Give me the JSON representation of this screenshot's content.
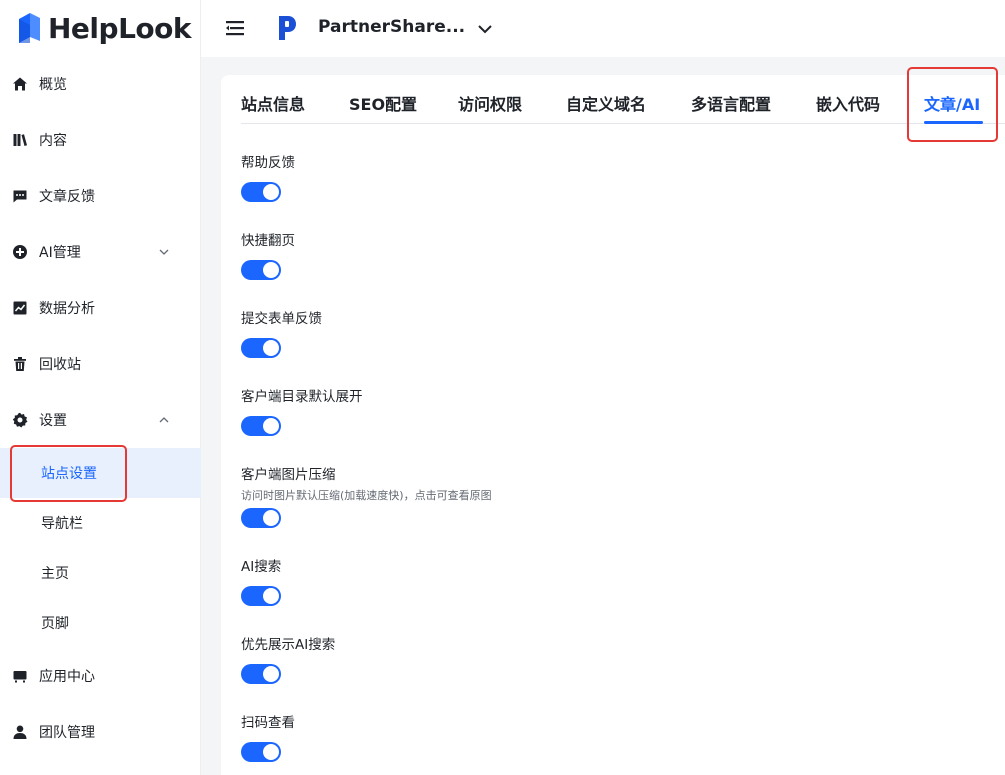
{
  "brand": {
    "name": "HelpLook"
  },
  "sidebar": {
    "items": [
      {
        "label": "概览",
        "icon": "home-icon"
      },
      {
        "label": "内容",
        "icon": "book-icon"
      },
      {
        "label": "文章反馈",
        "icon": "chat-icon"
      },
      {
        "label": "AI管理",
        "icon": "ai-icon"
      },
      {
        "label": "数据分析",
        "icon": "chart-icon"
      },
      {
        "label": "回收站",
        "icon": "trash-icon"
      },
      {
        "label": "设置",
        "icon": "gear-icon"
      },
      {
        "label": "应用中心",
        "icon": "store-icon"
      },
      {
        "label": "团队管理",
        "icon": "user-icon"
      }
    ],
    "settings_sub": [
      {
        "label": "站点设置",
        "active": true
      },
      {
        "label": "导航栏"
      },
      {
        "label": "主页"
      },
      {
        "label": "页脚"
      }
    ]
  },
  "header": {
    "workspace_name": "PartnerShare..."
  },
  "tabs": [
    {
      "label": "站点信息"
    },
    {
      "label": "SEO配置"
    },
    {
      "label": "访问权限"
    },
    {
      "label": "自定义域名"
    },
    {
      "label": "多语言配置"
    },
    {
      "label": "嵌入代码"
    },
    {
      "label": "文章/AI",
      "active": true
    }
  ],
  "settings": [
    {
      "title": "帮助反馈",
      "enabled": true
    },
    {
      "title": "快捷翻页",
      "enabled": true
    },
    {
      "title": "提交表单反馈",
      "enabled": true
    },
    {
      "title": "客户端目录默认展开",
      "enabled": true
    },
    {
      "title": "客户端图片压缩",
      "desc": "访问时图片默认压缩(加载速度快)，点击可查看原图",
      "enabled": true
    },
    {
      "title": "AI搜索",
      "enabled": true
    },
    {
      "title": "优先展示AI搜索",
      "enabled": true
    },
    {
      "title": "扫码查看",
      "enabled": true
    }
  ],
  "colors": {
    "accent": "#1a66ff",
    "highlight": "#e53935"
  }
}
